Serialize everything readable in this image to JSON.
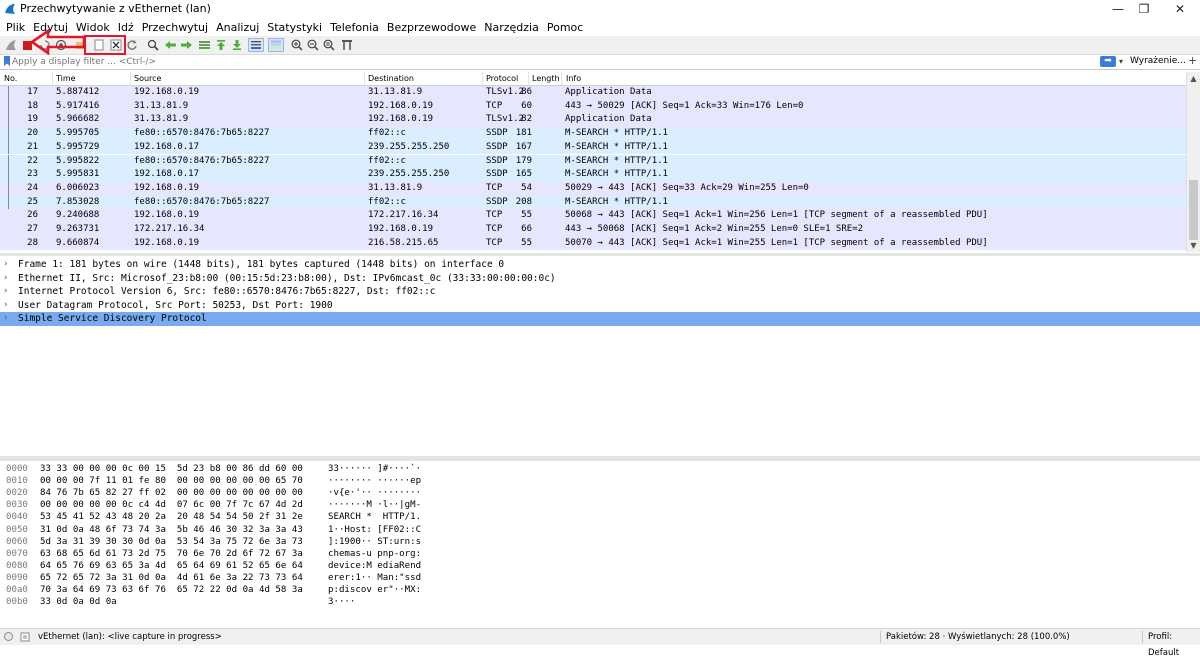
{
  "window": {
    "title": "Przechwytywanie z vEthernet (lan)",
    "minimize_icon": "minimize-icon",
    "maximize_icon": "maximize-icon",
    "close_icon": "close-icon"
  },
  "menu": [
    "Plik",
    "Edytuj",
    "Widok",
    "Idź",
    "Przechwytuj",
    "Analizuj",
    "Statystyki",
    "Telefonia",
    "Bezprzewodowe",
    "Narzędzia",
    "Pomoc"
  ],
  "toolbar": {
    "icons": [
      "start-capture-icon",
      "stop-capture-icon",
      "restart-capture-icon",
      "capture-options-icon",
      "open-file-icon",
      "save-file-icon",
      "close-file-icon",
      "reload-icon",
      "find-packet-icon",
      "go-back-icon",
      "go-forward-icon",
      "go-to-packet-icon",
      "go-first-icon",
      "go-last-icon",
      "autoscroll-icon",
      "colorize-icon",
      "zoom-in-icon",
      "zoom-out-icon",
      "zoom-normal-icon",
      "resize-columns-icon"
    ],
    "accent_stop": "#cc1b1b",
    "annotation_color": "#e4162b"
  },
  "filter": {
    "placeholder": "Apply a display filter ... <Ctrl-/>",
    "apply_icon": "arrow-right-icon",
    "expression_label": "Wyrażenie...",
    "add_label": "+"
  },
  "columns": [
    "No.",
    "Time",
    "Source",
    "Destination",
    "Protocol",
    "Length",
    "Info"
  ],
  "packets": [
    {
      "no": "17",
      "time": "5.887412",
      "src": "192.168.0.19",
      "dst": "31.13.81.9",
      "proto": "TLSv1.2",
      "len": "86",
      "info": "Application Data",
      "color": "#e7e6ff"
    },
    {
      "no": "18",
      "time": "5.917416",
      "src": "31.13.81.9",
      "dst": "192.168.0.19",
      "proto": "TCP",
      "len": "60",
      "info": "443 → 50029 [ACK] Seq=1 Ack=33 Win=176 Len=0",
      "color": "#e7e6ff"
    },
    {
      "no": "19",
      "time": "5.966682",
      "src": "31.13.81.9",
      "dst": "192.168.0.19",
      "proto": "TLSv1.2",
      "len": "82",
      "info": "Application Data",
      "color": "#e7e6ff"
    },
    {
      "no": "20",
      "time": "5.995705",
      "src": "fe80::6570:8476:7b65:8227",
      "dst": "ff02::c",
      "proto": "SSDP",
      "len": "181",
      "info": "M-SEARCH * HTTP/1.1",
      "color": "#daeeff"
    },
    {
      "no": "21",
      "time": "5.995729",
      "src": "192.168.0.17",
      "dst": "239.255.255.250",
      "proto": "SSDP",
      "len": "167",
      "info": "M-SEARCH * HTTP/1.1",
      "color": "#daeeff"
    },
    {
      "no": "22",
      "time": "5.995822",
      "src": "fe80::6570:8476:7b65:8227",
      "dst": "ff02::c",
      "proto": "SSDP",
      "len": "179",
      "info": "M-SEARCH * HTTP/1.1",
      "color": "#daeeff"
    },
    {
      "no": "23",
      "time": "5.995831",
      "src": "192.168.0.17",
      "dst": "239.255.255.250",
      "proto": "SSDP",
      "len": "165",
      "info": "M-SEARCH * HTTP/1.1",
      "color": "#daeeff"
    },
    {
      "no": "24",
      "time": "6.006023",
      "src": "192.168.0.19",
      "dst": "31.13.81.9",
      "proto": "TCP",
      "len": "54",
      "info": "50029 → 443 [ACK] Seq=33 Ack=29 Win=255 Len=0",
      "color": "#e7e6ff"
    },
    {
      "no": "25",
      "time": "7.853028",
      "src": "fe80::6570:8476:7b65:8227",
      "dst": "ff02::c",
      "proto": "SSDP",
      "len": "208",
      "info": "M-SEARCH * HTTP/1.1",
      "color": "#daeeff"
    },
    {
      "no": "26",
      "time": "9.240688",
      "src": "192.168.0.19",
      "dst": "172.217.16.34",
      "proto": "TCP",
      "len": "55",
      "info": "50068 → 443 [ACK] Seq=1 Ack=1 Win=256 Len=1 [TCP segment of a reassembled PDU]",
      "color": "#e7e6ff"
    },
    {
      "no": "27",
      "time": "9.263731",
      "src": "172.217.16.34",
      "dst": "192.168.0.19",
      "proto": "TCP",
      "len": "66",
      "info": "443 → 50068 [ACK] Seq=1 Ack=2 Win=255 Len=0 SLE=1 SRE=2",
      "color": "#e7e6ff"
    },
    {
      "no": "28",
      "time": "9.660874",
      "src": "192.168.0.19",
      "dst": "216.58.215.65",
      "proto": "TCP",
      "len": "55",
      "info": "50070 → 443 [ACK] Seq=1 Ack=1 Win=255 Len=1 [TCP segment of a reassembled PDU]",
      "color": "#e7e6ff"
    }
  ],
  "details": [
    {
      "text": "Frame 1: 181 bytes on wire (1448 bits), 181 bytes captured (1448 bits) on interface 0",
      "selected": false
    },
    {
      "text": "Ethernet II, Src: Microsof_23:b8:00 (00:15:5d:23:b8:00), Dst: IPv6mcast_0c (33:33:00:00:00:0c)",
      "selected": false
    },
    {
      "text": "Internet Protocol Version 6, Src: fe80::6570:8476:7b65:8227, Dst: ff02::c",
      "selected": false
    },
    {
      "text": "User Datagram Protocol, Src Port: 50253, Dst Port: 1900",
      "selected": false
    },
    {
      "text": "Simple Service Discovery Protocol",
      "selected": true
    }
  ],
  "selection_color": "#77aaee",
  "hex": [
    {
      "off": "0000",
      "hex": "33 33 00 00 00 0c 00 15  5d 23 b8 00 86 dd 60 00",
      "ascii": "33······ ]#····`·"
    },
    {
      "off": "0010",
      "hex": "00 00 00 7f 11 01 fe 80  00 00 00 00 00 00 65 70",
      "ascii": "········ ······ep"
    },
    {
      "off": "0020",
      "hex": "84 76 7b 65 82 27 ff 02  00 00 00 00 00 00 00 00",
      "ascii": "·v{e·'·· ········"
    },
    {
      "off": "0030",
      "hex": "00 00 00 00 00 0c c4 4d  07 6c 00 7f 7c 67 4d 2d",
      "ascii": "·······M ·l··|gM-"
    },
    {
      "off": "0040",
      "hex": "53 45 41 52 43 48 20 2a  20 48 54 54 50 2f 31 2e",
      "ascii": "SEARCH *  HTTP/1."
    },
    {
      "off": "0050",
      "hex": "31 0d 0a 48 6f 73 74 3a  5b 46 46 30 32 3a 3a 43",
      "ascii": "1··Host: [FF02::C"
    },
    {
      "off": "0060",
      "hex": "5d 3a 31 39 30 30 0d 0a  53 54 3a 75 72 6e 3a 73",
      "ascii": "]:1900·· ST:urn:s"
    },
    {
      "off": "0070",
      "hex": "63 68 65 6d 61 73 2d 75  70 6e 70 2d 6f 72 67 3a",
      "ascii": "chemas-u pnp-org:"
    },
    {
      "off": "0080",
      "hex": "64 65 76 69 63 65 3a 4d  65 64 69 61 52 65 6e 64",
      "ascii": "device:M ediaRend"
    },
    {
      "off": "0090",
      "hex": "65 72 65 72 3a 31 0d 0a  4d 61 6e 3a 22 73 73 64",
      "ascii": "erer:1·· Man:\"ssd"
    },
    {
      "off": "00a0",
      "hex": "70 3a 64 69 73 63 6f 76  65 72 22 0d 0a 4d 58 3a",
      "ascii": "p:discov er\"··MX:"
    },
    {
      "off": "00b0",
      "hex": "33 0d 0a 0d 0a",
      "ascii": "3····"
    }
  ],
  "status": {
    "interface": "vEthernet (lan): <live capture in progress>",
    "packets": "Pakietów: 28 · Wyświetlanych: 28 (100.0%)",
    "profile": "Profil: Default"
  }
}
